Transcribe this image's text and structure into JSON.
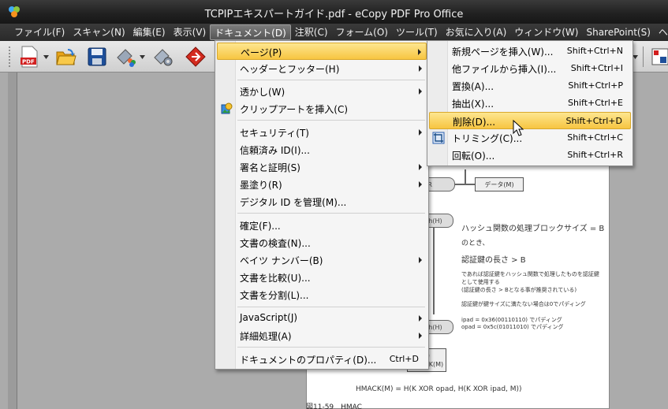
{
  "window": {
    "title": "TCPIPエキスパートガイド.pdf - eCopy PDF Pro Office"
  },
  "menubar": {
    "items": [
      {
        "label": "ファイル(F)"
      },
      {
        "label": "スキャン(N)"
      },
      {
        "label": "編集(E)"
      },
      {
        "label": "表示(V)"
      },
      {
        "label": "ドキュメント(D)"
      },
      {
        "label": "注釈(C)"
      },
      {
        "label": "フォーム(O)"
      },
      {
        "label": "ツール(T)"
      },
      {
        "label": "お気に入り(A)"
      },
      {
        "label": "ウィンドウ(W)"
      },
      {
        "label": "SharePoint(S)"
      },
      {
        "label": "ヘ"
      }
    ],
    "active_index": 4
  },
  "document_menu": {
    "items": [
      {
        "label": "ページ(P)",
        "submenu": true
      },
      {
        "label": "ヘッダーとフッター(H)",
        "submenu": true
      },
      {
        "label": "透かし(W)",
        "submenu": true
      },
      {
        "label": "クリップアートを挿入(C)",
        "icon": "clipart-icon"
      },
      {
        "label": "セキュリティ(T)",
        "submenu": true
      },
      {
        "label": "信頼済み ID(I)..."
      },
      {
        "label": "署名と証明(S)",
        "submenu": true
      },
      {
        "label": "墨塗り(R)",
        "submenu": true
      },
      {
        "label": "デジタル ID を管理(M)..."
      },
      {
        "label": "確定(F)..."
      },
      {
        "label": "文書の検査(N)..."
      },
      {
        "label": "ベイツ ナンバー(B)",
        "submenu": true
      },
      {
        "label": "文書を比較(U)..."
      },
      {
        "label": "文書を分割(L)..."
      },
      {
        "label": "JavaScript(J)",
        "submenu": true
      },
      {
        "label": "詳細処理(A)",
        "submenu": true
      },
      {
        "label": "ドキュメントのプロパティ(D)...",
        "shortcut": "Ctrl+D"
      }
    ]
  },
  "page_submenu": {
    "items": [
      {
        "label": "新規ページを挿入(W)...",
        "shortcut": "Shift+Ctrl+N"
      },
      {
        "label": "他ファイルから挿入(I)...",
        "shortcut": "Shift+Ctrl+I"
      },
      {
        "label": "置換(A)...",
        "shortcut": "Shift+Ctrl+P"
      },
      {
        "label": "抽出(X)...",
        "shortcut": "Shift+Ctrl+E"
      },
      {
        "label": "削除(D)...",
        "shortcut": "Shift+Ctrl+D"
      },
      {
        "label": "トリミング(C)...",
        "shortcut": "Shift+Ctrl+C",
        "icon": "crop-icon"
      },
      {
        "label": "回転(O)...",
        "shortcut": "Shift+Ctrl+R"
      }
    ],
    "highlighted_index": 4
  },
  "document_page": {
    "xor_label": "OR",
    "data_label": "データ(M)",
    "hash_label_1": "h(H)",
    "hash_label_2": "h(H)",
    "output_label_1": "力",
    "output_label_2": "HMACK(M)",
    "line1": "ハッシュ関数の処理ブロックサイズ = B",
    "line2": "のとき、",
    "line3": "認証鍵の長さ > B",
    "line4": "であれば認証鍵をハッシュ関数で処理したものを認証鍵",
    "line5": "として使用する",
    "line6": "(認証鍵の長さ > Bとなる事が推奨されている)",
    "line7": "認証鍵が鍵サイズに満たない場合は0でパディング",
    "line8": "ipad = 0x36(00110110) でパディング",
    "line9": "opad = 0x5c(01011010) でパディング",
    "formula": "HMACK(M) = H(K XOR opad, H(K XOR ipad, M))",
    "caption": "図11-59　HMAC"
  },
  "colors": {
    "highlight": "#f7c541",
    "titlebar": "#202020",
    "workspace": "#ababab"
  }
}
